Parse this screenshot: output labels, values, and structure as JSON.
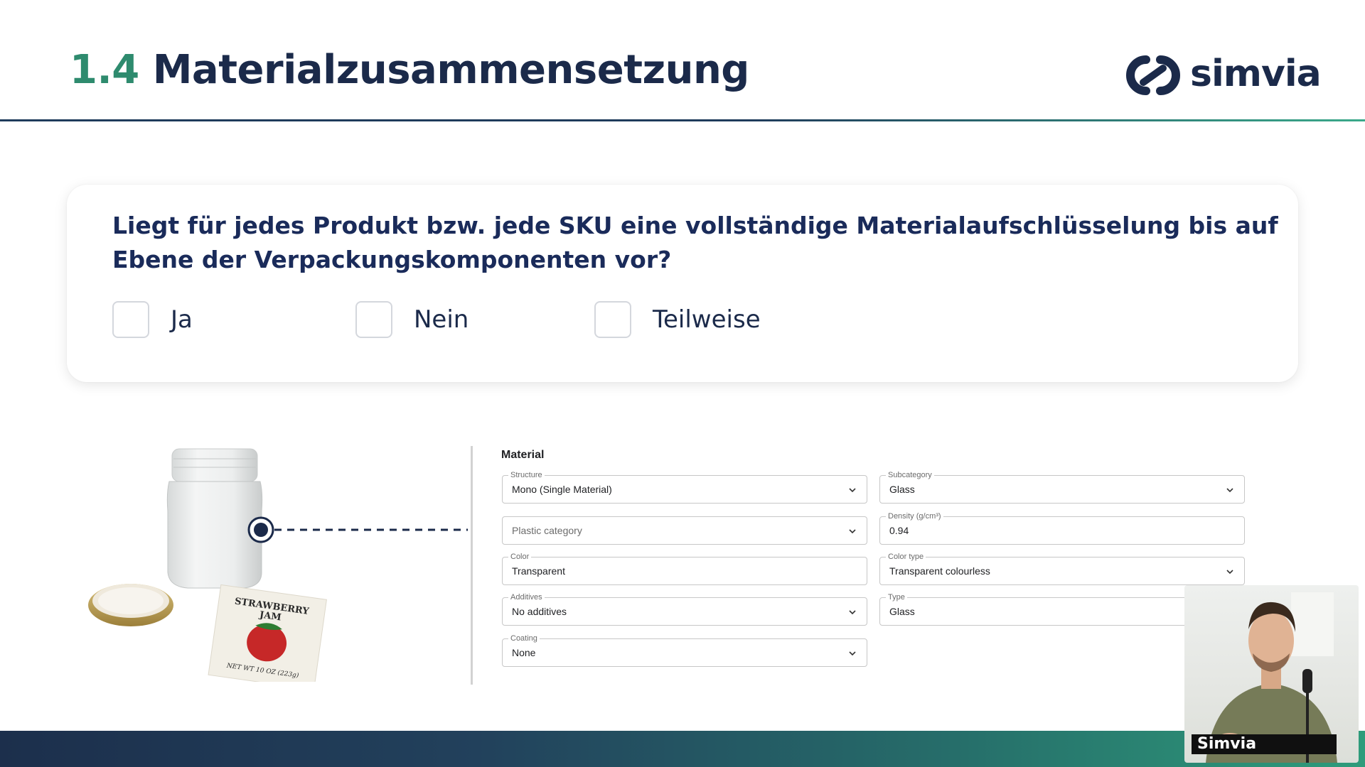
{
  "header": {
    "section_number": "1.4",
    "title": "Materialzusammensetzung",
    "logo_text": "simvia"
  },
  "question": {
    "text": "Liegt für jedes Produkt bzw. jede SKU eine vollständige Materialaufschlüsselung bis auf Ebene der Verpackungskomponenten vor?",
    "options": [
      {
        "label": "Ja",
        "checked": false
      },
      {
        "label": "Nein",
        "checked": false
      },
      {
        "label": "Teilweise",
        "checked": false
      }
    ]
  },
  "illustration": {
    "label_line1": "STRAWBERRY",
    "label_line2": "JAM",
    "label_weight": "NET WT 10 OZ (223g)"
  },
  "material_form": {
    "title": "Material",
    "fields": {
      "structure": {
        "label": "Structure",
        "value": "Mono (Single Material)",
        "type": "select"
      },
      "subcategory": {
        "label": "Subcategory",
        "value": "Glass",
        "type": "select"
      },
      "plastic_category": {
        "placeholder": "Plastic category",
        "type": "select"
      },
      "density": {
        "label": "Density (g/cm³)",
        "value": "0.94",
        "type": "input"
      },
      "color": {
        "label": "Color",
        "value": "Transparent",
        "type": "input"
      },
      "color_type": {
        "label": "Color type",
        "value": "Transparent colourless",
        "type": "select"
      },
      "additives": {
        "label": "Additives",
        "value": "No additives",
        "type": "select"
      },
      "type": {
        "label": "Type",
        "value": "Glass",
        "type": "input"
      },
      "coating": {
        "label": "Coating",
        "value": "None",
        "type": "select"
      }
    }
  },
  "video": {
    "name": "Simvia"
  },
  "colors": {
    "title_navy": "#1b2a4a",
    "accent_green": "#2e8b6e",
    "question_navy": "#1a2b5a"
  }
}
